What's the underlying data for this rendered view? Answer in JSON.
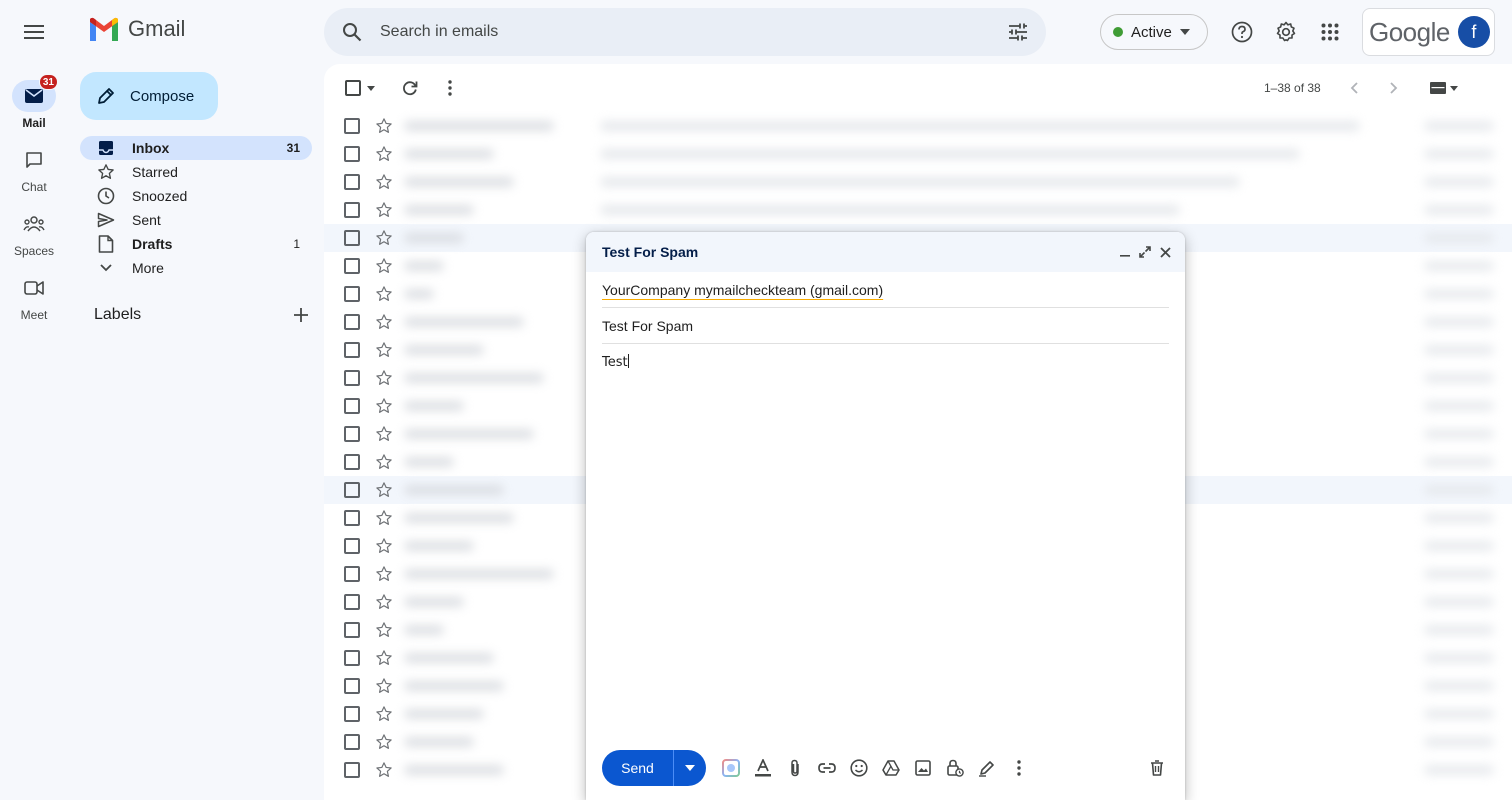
{
  "app": {
    "name": "Gmail",
    "account_initial": "f",
    "google_word": "Google"
  },
  "rail": {
    "mail": {
      "label": "Mail",
      "badge": "31"
    },
    "chat": {
      "label": "Chat"
    },
    "spaces": {
      "label": "Spaces"
    },
    "meet": {
      "label": "Meet"
    }
  },
  "compose_button": {
    "label": "Compose"
  },
  "nav": {
    "items": [
      {
        "label": "Inbox",
        "count": "31",
        "icon": "inbox-icon"
      },
      {
        "label": "Starred",
        "count": "",
        "icon": "star-icon"
      },
      {
        "label": "Snoozed",
        "count": "",
        "icon": "clock-icon"
      },
      {
        "label": "Sent",
        "count": "",
        "icon": "send-icon"
      },
      {
        "label": "Drafts",
        "count": "1",
        "icon": "draft-icon"
      },
      {
        "label": "More",
        "count": "",
        "icon": "chevron-down-icon"
      }
    ]
  },
  "labels": {
    "title": "Labels"
  },
  "search": {
    "placeholder": "Search in emails"
  },
  "status": {
    "label": "Active"
  },
  "list": {
    "page_info": "1–38 of 38"
  },
  "compose_window": {
    "title": "Test For Spam",
    "to": "YourCompany mymailcheckteam (gmail.com)",
    "subject": "Test For Spam",
    "body": "Test",
    "send_label": "Send"
  },
  "colors": {
    "accent": "#0b57d0",
    "compose_bg": "#c2e7ff",
    "active_nav": "#d3e3fd",
    "badge": "#c5221f",
    "status_green": "#3f9c35"
  }
}
